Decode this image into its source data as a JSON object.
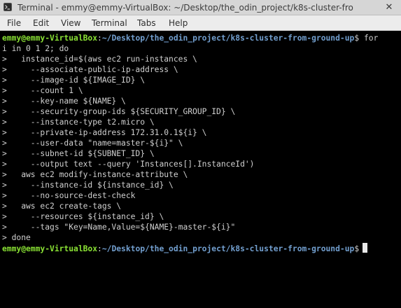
{
  "window": {
    "title": "Terminal - emmy@emmy-VirtualBox: ~/Desktop/the_odin_project/k8s-cluster-fro",
    "app_icon": "terminal-app-icon",
    "close_icon": "close-icon",
    "close_glyph": "✕"
  },
  "menubar": {
    "items": [
      "File",
      "Edit",
      "View",
      "Terminal",
      "Tabs",
      "Help"
    ]
  },
  "terminal": {
    "prompt_user": "emmy@emmy-VirtualBox",
    "prompt_sep": ":",
    "prompt_path": "~/Desktop/the_odin_project/k8s-cluster-from-ground-up",
    "prompt_end": "$",
    "first_command_start": " for",
    "lines": [
      "i in 0 1 2; do",
      ">   instance_id=$(aws ec2 run-instances \\",
      ">     --associate-public-ip-address \\",
      ">     --image-id ${IMAGE_ID} \\",
      ">     --count 1 \\",
      ">     --key-name ${NAME} \\",
      ">     --security-group-ids ${SECURITY_GROUP_ID} \\",
      ">     --instance-type t2.micro \\",
      ">     --private-ip-address 172.31.0.1${i} \\",
      ">     --user-data \"name=master-${i}\" \\",
      ">     --subnet-id ${SUBNET_ID} \\",
      ">     --output text --query 'Instances[].InstanceId')",
      ">   aws ec2 modify-instance-attribute \\",
      ">     --instance-id ${instance_id} \\",
      ">     --no-source-dest-check",
      ">   aws ec2 create-tags \\",
      ">     --resources ${instance_id} \\",
      ">     --tags \"Key=Name,Value=${NAME}-master-${i}\"",
      "> done"
    ]
  },
  "colors": {
    "background": "#000000",
    "text": "#d0d0d0",
    "prompt_user": "#8ae234",
    "prompt_path": "#729fcf",
    "titlebar": "#d6d6d6",
    "menubar": "#ececec"
  }
}
